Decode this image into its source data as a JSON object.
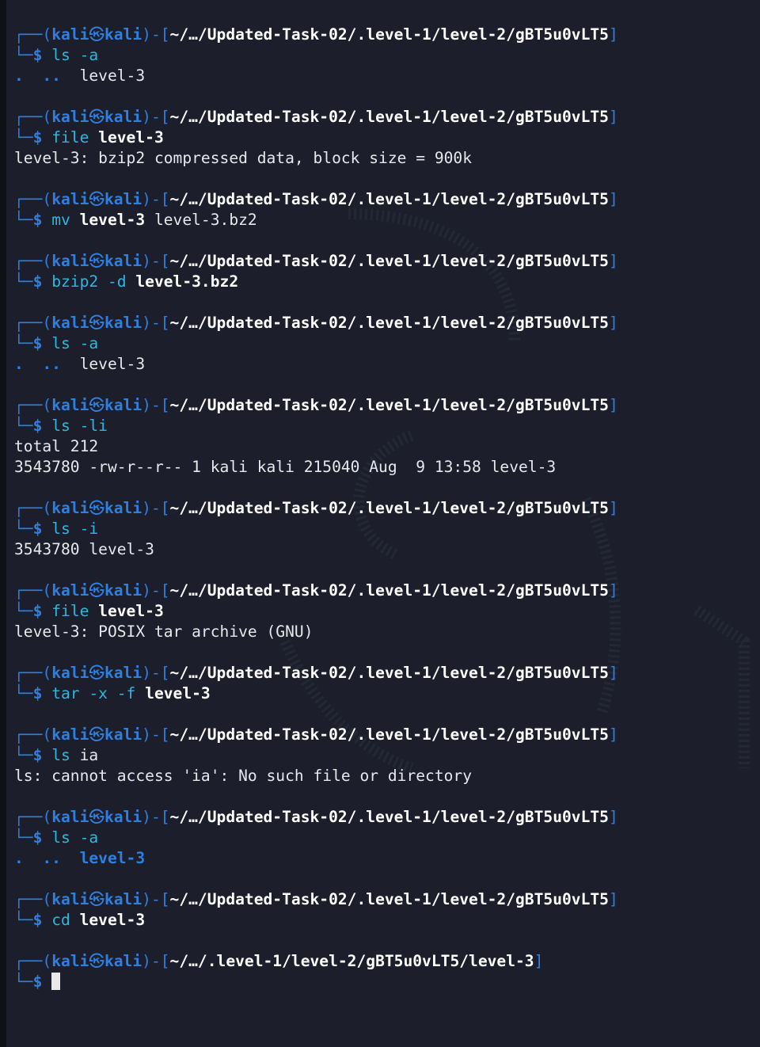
{
  "prompt": {
    "user": "kali",
    "host": "kali",
    "skull": "㉿",
    "top_prefix": "┌──(",
    "mid_sep": ")-[",
    "close": "]",
    "bottom_prefix": "└─",
    "dollar": "$"
  },
  "blocks": [
    {
      "path": "~/…/Updated-Task-02/.level-1/level-2/gBT5u0vLT5",
      "cmd": [
        {
          "t": "ls",
          "s": "cmd"
        },
        {
          "t": " -a",
          "s": "arg"
        }
      ],
      "out": [
        [
          {
            "t": ".",
            "s": "dot"
          },
          {
            "t": "  ",
            "s": "out"
          },
          {
            "t": "..",
            "s": "dot"
          },
          {
            "t": "  level-3",
            "s": "out"
          }
        ]
      ]
    },
    {
      "path": "~/…/Updated-Task-02/.level-1/level-2/gBT5u0vLT5",
      "cmd": [
        {
          "t": "file",
          "s": "cmd"
        },
        {
          "t": " ",
          "s": "out"
        },
        {
          "t": "level-3",
          "s": "argb"
        }
      ],
      "out": [
        [
          {
            "t": "level-3: bzip2 compressed data, block size = 900k",
            "s": "out"
          }
        ]
      ]
    },
    {
      "path": "~/…/Updated-Task-02/.level-1/level-2/gBT5u0vLT5",
      "cmd": [
        {
          "t": "mv",
          "s": "cmd"
        },
        {
          "t": " ",
          "s": "out"
        },
        {
          "t": "level-3",
          "s": "argb"
        },
        {
          "t": " level-3.bz2",
          "s": "out"
        }
      ],
      "out": []
    },
    {
      "path": "~/…/Updated-Task-02/.level-1/level-2/gBT5u0vLT5",
      "cmd": [
        {
          "t": "bzip2",
          "s": "cmd"
        },
        {
          "t": " -d ",
          "s": "arg"
        },
        {
          "t": "level-3.bz2",
          "s": "argb"
        }
      ],
      "out": []
    },
    {
      "path": "~/…/Updated-Task-02/.level-1/level-2/gBT5u0vLT5",
      "cmd": [
        {
          "t": "ls",
          "s": "cmd"
        },
        {
          "t": " -a",
          "s": "arg"
        }
      ],
      "out": [
        [
          {
            "t": ".",
            "s": "dot"
          },
          {
            "t": "  ",
            "s": "out"
          },
          {
            "t": "..",
            "s": "dot"
          },
          {
            "t": "  level-3",
            "s": "out"
          }
        ]
      ]
    },
    {
      "path": "~/…/Updated-Task-02/.level-1/level-2/gBT5u0vLT5",
      "cmd": [
        {
          "t": "ls",
          "s": "cmd"
        },
        {
          "t": " -li",
          "s": "arg"
        }
      ],
      "out": [
        [
          {
            "t": "total 212",
            "s": "out"
          }
        ],
        [
          {
            "t": "3543780 -rw-r--r-- 1 kali kali 215040 Aug  9 13:58 level-3",
            "s": "out"
          }
        ]
      ]
    },
    {
      "path": "~/…/Updated-Task-02/.level-1/level-2/gBT5u0vLT5",
      "cmd": [
        {
          "t": "ls",
          "s": "cmd"
        },
        {
          "t": " -i",
          "s": "arg"
        }
      ],
      "out": [
        [
          {
            "t": "3543780 level-3",
            "s": "out"
          }
        ]
      ]
    },
    {
      "path": "~/…/Updated-Task-02/.level-1/level-2/gBT5u0vLT5",
      "cmd": [
        {
          "t": "file",
          "s": "cmd"
        },
        {
          "t": " ",
          "s": "out"
        },
        {
          "t": "level-3",
          "s": "argb"
        }
      ],
      "out": [
        [
          {
            "t": "level-3: POSIX tar archive (GNU)",
            "s": "out"
          }
        ]
      ]
    },
    {
      "path": "~/…/Updated-Task-02/.level-1/level-2/gBT5u0vLT5",
      "cmd": [
        {
          "t": "tar",
          "s": "cmd"
        },
        {
          "t": " -x -f ",
          "s": "arg"
        },
        {
          "t": "level-3",
          "s": "argb"
        }
      ],
      "out": []
    },
    {
      "path": "~/…/Updated-Task-02/.level-1/level-2/gBT5u0vLT5",
      "cmd": [
        {
          "t": "ls",
          "s": "cmd"
        },
        {
          "t": " ia",
          "s": "out"
        }
      ],
      "out": [
        [
          {
            "t": "ls: cannot access 'ia': No such file or directory",
            "s": "out"
          }
        ]
      ]
    },
    {
      "path": "~/…/Updated-Task-02/.level-1/level-2/gBT5u0vLT5",
      "cmd": [
        {
          "t": "ls",
          "s": "cmd"
        },
        {
          "t": " -a",
          "s": "arg"
        }
      ],
      "out": [
        [
          {
            "t": ".",
            "s": "dot"
          },
          {
            "t": "  ",
            "s": "out"
          },
          {
            "t": "..",
            "s": "dot"
          },
          {
            "t": "  ",
            "s": "out"
          },
          {
            "t": "level-3",
            "s": "dirname"
          }
        ]
      ]
    },
    {
      "path": "~/…/Updated-Task-02/.level-1/level-2/gBT5u0vLT5",
      "cmd": [
        {
          "t": "cd",
          "s": "cmd"
        },
        {
          "t": " ",
          "s": "out"
        },
        {
          "t": "level-3",
          "s": "argb"
        }
      ],
      "out": []
    },
    {
      "path": "~/…/.level-1/level-2/gBT5u0vLT5/level-3",
      "cmd": [],
      "cursor": true,
      "out": []
    }
  ],
  "colors": {
    "background": "#1c1f2b",
    "prompt_blue": "#2f7fe0",
    "command_cyan": "#2fb6de",
    "text": "#e6e8ec"
  }
}
